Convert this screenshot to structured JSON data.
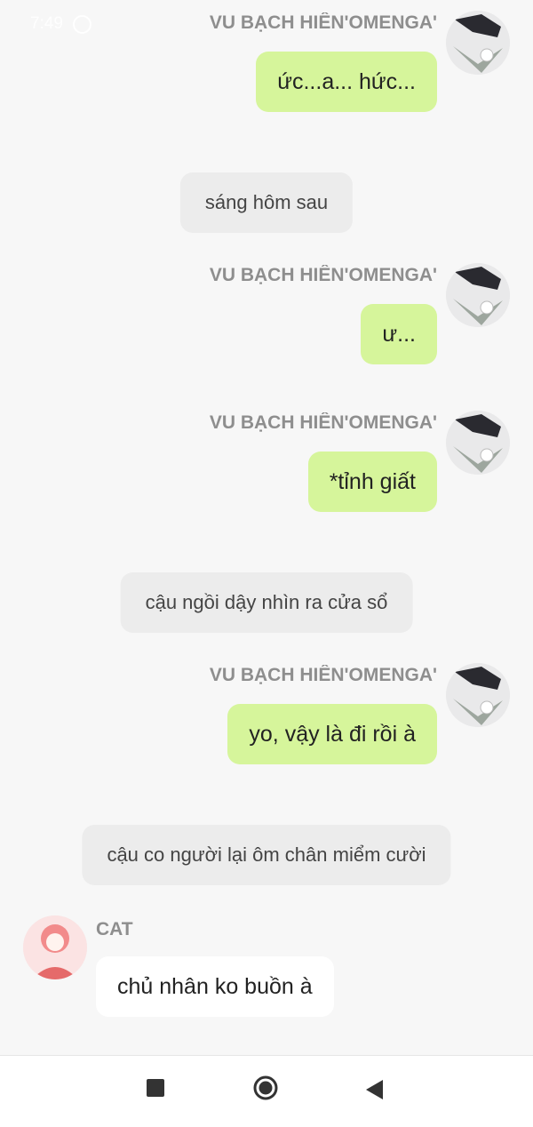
{
  "status_bar": {
    "time": "7:49"
  },
  "characters": {
    "right": {
      "name": "VU BẠCH HIÊN'OMENGA'"
    },
    "left": {
      "name": "CAT"
    }
  },
  "messages": [
    {
      "type": "right",
      "text": "ức...a... hức..."
    },
    {
      "type": "narration",
      "text": "sáng hôm sau"
    },
    {
      "type": "right",
      "text": "ư..."
    },
    {
      "type": "right",
      "text": "*tỉnh giất"
    },
    {
      "type": "narration",
      "text": "cậu ngồi dậy nhìn ra cửa sổ"
    },
    {
      "type": "right",
      "text": "yo, vậy là đi rồi à"
    },
    {
      "type": "narration",
      "text": "cậu co người lại ôm chân miểm cười"
    },
    {
      "type": "left",
      "text": "chủ nhân ko buồn à"
    }
  ],
  "navbar": {
    "recents_icon": "square-icon",
    "home_icon": "circle-home-icon",
    "back_icon": "triangle-back-icon"
  },
  "colors": {
    "green_bubble": "#d6f59b",
    "narration_bg": "#ececec",
    "background": "#f7f7f7"
  }
}
